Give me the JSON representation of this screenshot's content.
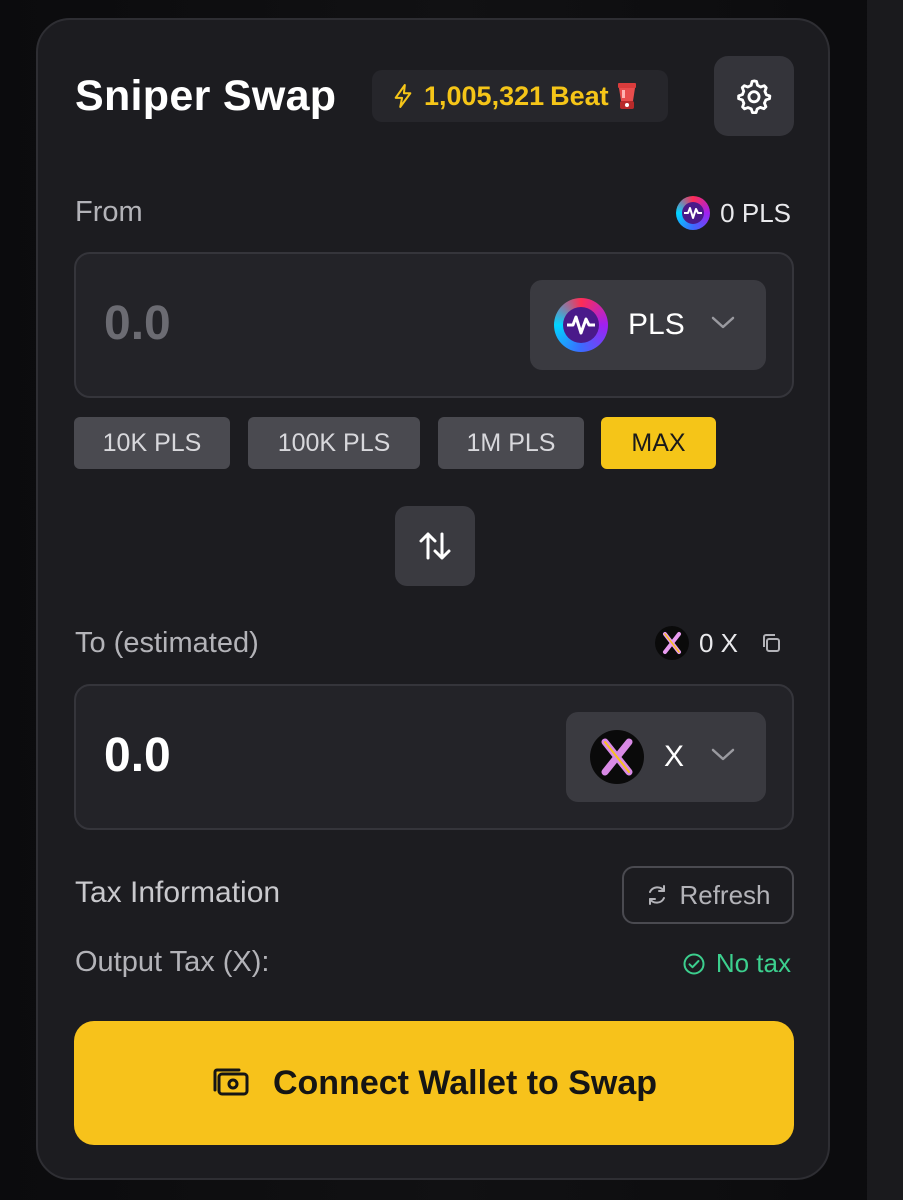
{
  "header": {
    "title": "Sniper Swap",
    "beat_balance": "1,005,321",
    "beat_unit": "Beat"
  },
  "from": {
    "label": "From",
    "balance": "0 PLS",
    "amount_placeholder": "0.0",
    "token": "PLS"
  },
  "quick_amounts": [
    "10K PLS",
    "100K PLS",
    "1M PLS",
    "MAX"
  ],
  "to": {
    "label": "To (estimated)",
    "balance": "0 X",
    "amount": "0.0",
    "token": "X"
  },
  "tax": {
    "heading": "Tax Information",
    "refresh_label": "Refresh",
    "output_label": "Output Tax (X):",
    "output_value": "No tax"
  },
  "connect_button": "Connect Wallet to Swap",
  "colors": {
    "accent": "#f7c21b",
    "success": "#3ccf8e",
    "card_bg": "#1c1c20"
  },
  "icons": [
    "bolt-icon",
    "blender-icon",
    "gear-icon",
    "pls-logo",
    "chevron-down-icon",
    "swap-arrows-icon",
    "x-logo",
    "copy-icon",
    "refresh-icon",
    "check-circle-icon",
    "wallet-icon"
  ]
}
